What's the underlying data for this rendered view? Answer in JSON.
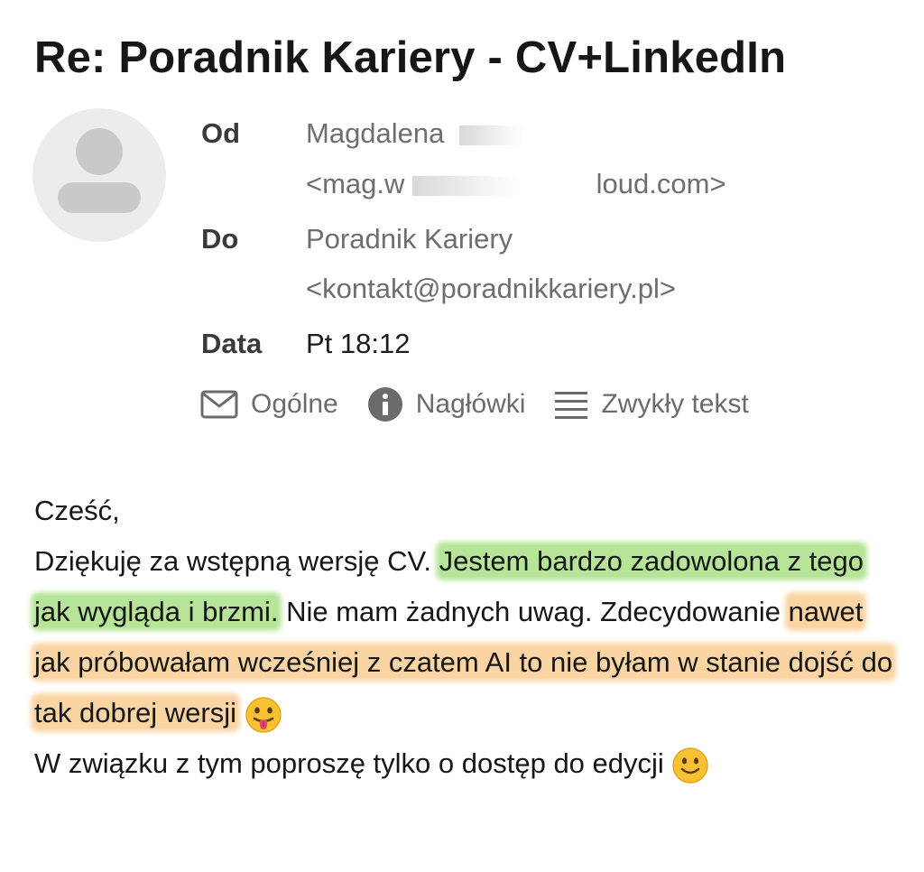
{
  "email": {
    "subject": "Re: Poradnik Kariery - CV+LinkedIn",
    "from_label": "Od",
    "from_name": "Magdalena",
    "from_email_start": "<mag.w",
    "from_email_end": "loud.com>",
    "to_label": "Do",
    "to_name": "Poradnik Kariery",
    "to_email": "<kontakt@poradnikkariery.pl>",
    "date_label": "Data",
    "date_value": "Pt 18:12"
  },
  "views": [
    {
      "label": "Ogólne",
      "icon": "envelope-icon"
    },
    {
      "label": "Nagłówki",
      "icon": "info-icon"
    },
    {
      "label": "Zwykły tekst",
      "icon": "lines-icon"
    }
  ],
  "body": {
    "greeting": "Cześć,",
    "p1_plain": "Dziękuję za wstępną wersję CV.",
    "p1_green": "Jestem bardzo zadowolona z tego jak wygląda i brzmi.",
    "p1_plain2": "Nie mam żadnych uwag. Zdecydowanie",
    "p1_orange": "nawet jak próbowałam wcześniej z czatem AI to nie byłam w stanie dojść do tak dobrej wersji",
    "p2": "W związku z tym poproszę tylko o dostęp do edycji"
  },
  "emojis": {
    "tongue": "face-with-tongue-icon",
    "smile": "slightly-smiling-face-icon"
  },
  "colors": {
    "highlight_green": "#b6e59a",
    "highlight_orange": "#fbd4a4",
    "icon_gray": "#6b6b6b"
  }
}
